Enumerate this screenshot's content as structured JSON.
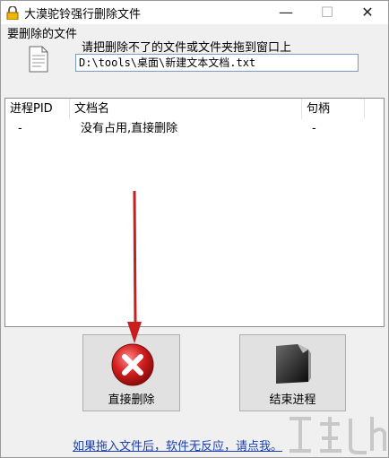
{
  "window": {
    "title": "大漠驼铃强行删除文件",
    "controls": {
      "minimize": "—",
      "maximize": "☐",
      "close": "✕"
    }
  },
  "file_group": {
    "label": "要删除的文件",
    "instruction": "请把删除不了的文件或文件夹拖到窗口上",
    "path_value": "D:\\tools\\桌面\\新建文本文档.txt"
  },
  "process_list": {
    "columns": [
      "进程PID",
      "文档名",
      "句柄"
    ],
    "rows": [
      {
        "pid": "-",
        "name": "没有占用,直接删除",
        "handle": "-"
      }
    ]
  },
  "buttons": {
    "delete_label": "直接删除",
    "end_process_label": "结束进程"
  },
  "help_link": "如果拖入文件后，软件无反应，请点我。",
  "colors": {
    "link": "#1a3fb5",
    "delete_icon": "#d42020",
    "arrow": "#c81e1e"
  },
  "icons": [
    "lock-icon",
    "document-icon",
    "delete-x-icon",
    "folder-icon",
    "down-arrow-annotation"
  ]
}
